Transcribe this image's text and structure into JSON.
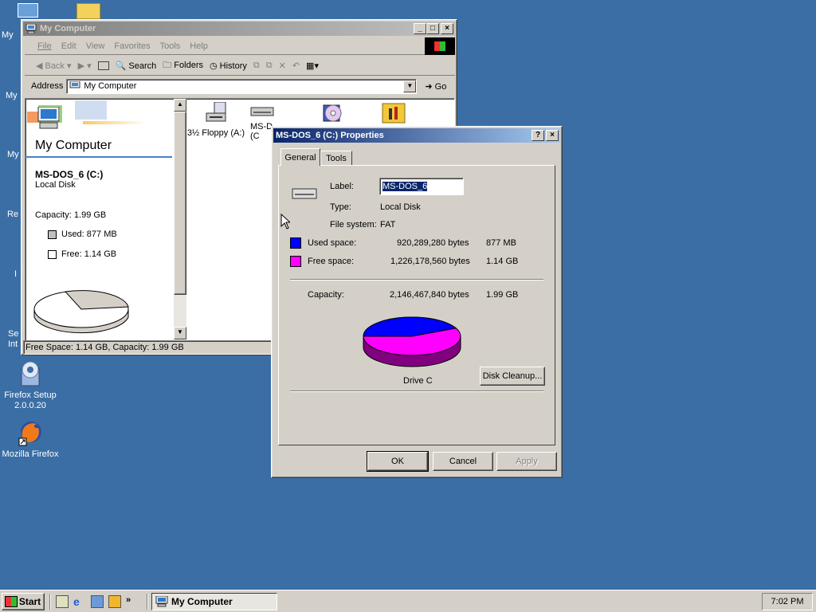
{
  "desktop": {
    "icons": [
      {
        "label_l1": "Firefox Setup",
        "label_l2": "2.0.0.20"
      },
      {
        "label": "Mozilla Firefox"
      }
    ],
    "partial": [
      "My",
      "My",
      "My",
      "Re",
      "I",
      "Se",
      "Int"
    ]
  },
  "explorer": {
    "title": "My Computer",
    "menu": [
      "File",
      "Edit",
      "View",
      "Favorites",
      "Tools",
      "Help"
    ],
    "toolbar": {
      "back": "Back",
      "search": "Search",
      "folders": "Folders",
      "history": "History"
    },
    "address": {
      "label": "Address",
      "value": "My Computer",
      "go": "Go"
    },
    "left": {
      "heading": "My Computer",
      "drive_name": "MS-DOS_6 (C:)",
      "drive_type": "Local Disk",
      "capacity": "Capacity: 1.99 GB",
      "used": "Used: 877 MB",
      "free": "Free: 1.14 GB"
    },
    "items": [
      {
        "label": "3½ Floppy (A:)"
      },
      {
        "label": "MS-D"
      },
      {
        "label": ""
      },
      {
        "label": ""
      }
    ],
    "item_sub": "(C",
    "status": "Free Space: 1.14 GB, Capacity: 1.99 GB"
  },
  "dialog": {
    "title": "MS-DOS_6 (C:) Properties",
    "tabs": [
      "General",
      "Tools"
    ],
    "label_caption": "Label:",
    "label_value": "MS-DOS_6",
    "type_caption": "Type:",
    "type_value": "Local Disk",
    "fs_caption": "File system:",
    "fs_value": "FAT",
    "used_caption": "Used space:",
    "used_bytes": "920,289,280 bytes",
    "used_size": "877 MB",
    "free_caption": "Free space:",
    "free_bytes": "1,226,178,560 bytes",
    "free_size": "1.14 GB",
    "cap_caption": "Capacity:",
    "cap_bytes": "2,146,467,840 bytes",
    "cap_size": "1.99 GB",
    "drive_caption": "Drive C",
    "cleanup": "Disk Cleanup...",
    "ok": "OK",
    "cancel": "Cancel",
    "apply": "Apply",
    "used_fraction": 0.43,
    "colors": {
      "used": "#0000ff",
      "free": "#ff00ff"
    }
  },
  "taskbar": {
    "start": "Start",
    "task": "My Computer",
    "clock": "7:02 PM",
    "chevron": "»"
  }
}
